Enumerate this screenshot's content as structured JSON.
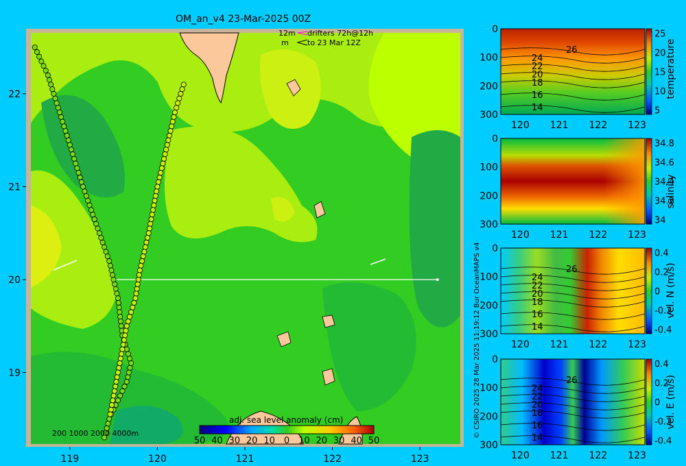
{
  "page": {
    "title": "OM_an_v4  23-Mar-2025 00Z",
    "copyright": "© CSIRO 2025   28 Mar 2025 11:19:12 Bur OceanMAPS v4",
    "drifter_legend": {
      "line1_left": "12m",
      "line1_right": "drifters 72h@12h",
      "line2_left": "m",
      "line2_right": "to 23 Mar 12Z"
    },
    "depth_legend": "200  1000  2000  4000m",
    "colorbar": {
      "label": "adj. sea level anomaly (cm)",
      "ticks": [
        "-50",
        "-40",
        "-30",
        "-20",
        "-10",
        "0",
        "10",
        "20",
        "30",
        "40",
        "50"
      ],
      "tick_text": [
        "50",
        "40",
        "30",
        "20",
        "10",
        "0",
        "10",
        "20",
        "30",
        "40",
        "50"
      ]
    },
    "colors": {
      "background": "#00ccff",
      "land": "#fac89b",
      "drifter_line": "#ff00ff"
    }
  },
  "chart_data": [
    {
      "type": "heatmap",
      "name": "sea-level-anomaly-map",
      "xlabel": "",
      "ylabel": "",
      "xticks": [
        119,
        120,
        121,
        122,
        123
      ],
      "yticks": [
        19,
        20,
        21,
        22
      ],
      "xlim": [
        118.5,
        123.5
      ],
      "ylim": [
        18.2,
        22.7
      ],
      "section_line": {
        "lon": [
          119.5,
          123.2
        ],
        "lat": [
          20.0,
          20.0
        ]
      },
      "drifter_tracks": [
        {
          "lon": [
            118.6,
            118.75,
            118.95,
            119.15,
            119.3,
            119.45,
            119.55,
            119.6,
            119.7,
            119.65,
            119.55,
            119.45,
            119.38
          ],
          "lat": [
            22.5,
            22.2,
            21.6,
            21.0,
            20.6,
            20.2,
            19.8,
            19.4,
            19.1,
            18.9,
            18.7,
            18.5,
            18.25
          ]
        },
        {
          "lon": [
            120.3,
            120.2,
            120.1,
            120.0,
            119.9,
            119.8,
            119.75,
            119.65,
            119.55,
            119.45
          ],
          "lat": [
            22.1,
            21.8,
            21.4,
            21.0,
            20.5,
            20.1,
            19.8,
            19.5,
            19.0,
            18.5
          ]
        }
      ],
      "colorbar": {
        "label": "adj. sea level anomaly (cm)",
        "range": [
          -50,
          50
        ]
      }
    },
    {
      "type": "heatmap",
      "name": "temperature-section",
      "ylabel": "temperature",
      "xticks": [
        120,
        121,
        122,
        123
      ],
      "yticks": [
        0,
        100,
        200,
        300
      ],
      "xlim": [
        119.5,
        123.2
      ],
      "ylim": [
        300,
        0
      ],
      "contour_labels": [
        "26",
        "24",
        "22",
        "20",
        "18",
        "16",
        "14"
      ],
      "colorbar_ticks": [
        5,
        10,
        15,
        20,
        25
      ]
    },
    {
      "type": "heatmap",
      "name": "salinity-section",
      "ylabel": "salinity",
      "xticks": [
        120,
        121,
        122,
        123
      ],
      "yticks": [
        0,
        100,
        200,
        300
      ],
      "xlim": [
        119.5,
        123.2
      ],
      "ylim": [
        300,
        0
      ],
      "colorbar_ticks": [
        34,
        34.2,
        34.4,
        34.6,
        34.8
      ]
    },
    {
      "type": "heatmap",
      "name": "vel-n-section",
      "ylabel": "vel. N (m/s)",
      "xticks": [
        120,
        121,
        122,
        123
      ],
      "yticks": [
        0,
        100,
        200,
        300
      ],
      "xlim": [
        119.5,
        123.2
      ],
      "ylim": [
        300,
        0
      ],
      "contour_labels": [
        "26",
        "24",
        "22",
        "20",
        "18",
        "16",
        "14"
      ],
      "colorbar_ticks": [
        -0.4,
        -0.2,
        0,
        0.2,
        0.4
      ]
    },
    {
      "type": "heatmap",
      "name": "vel-e-section",
      "ylabel": "vel. E (m/s)",
      "xticks": [
        120,
        121,
        122,
        123
      ],
      "yticks": [
        0,
        100,
        200,
        300
      ],
      "xlim": [
        119.5,
        123.2
      ],
      "ylim": [
        300,
        0
      ],
      "contour_labels": [
        "26",
        "24",
        "22",
        "20",
        "18",
        "16",
        "14"
      ],
      "colorbar_ticks": [
        -0.4,
        -0.2,
        0,
        0.2,
        0.4
      ]
    }
  ]
}
